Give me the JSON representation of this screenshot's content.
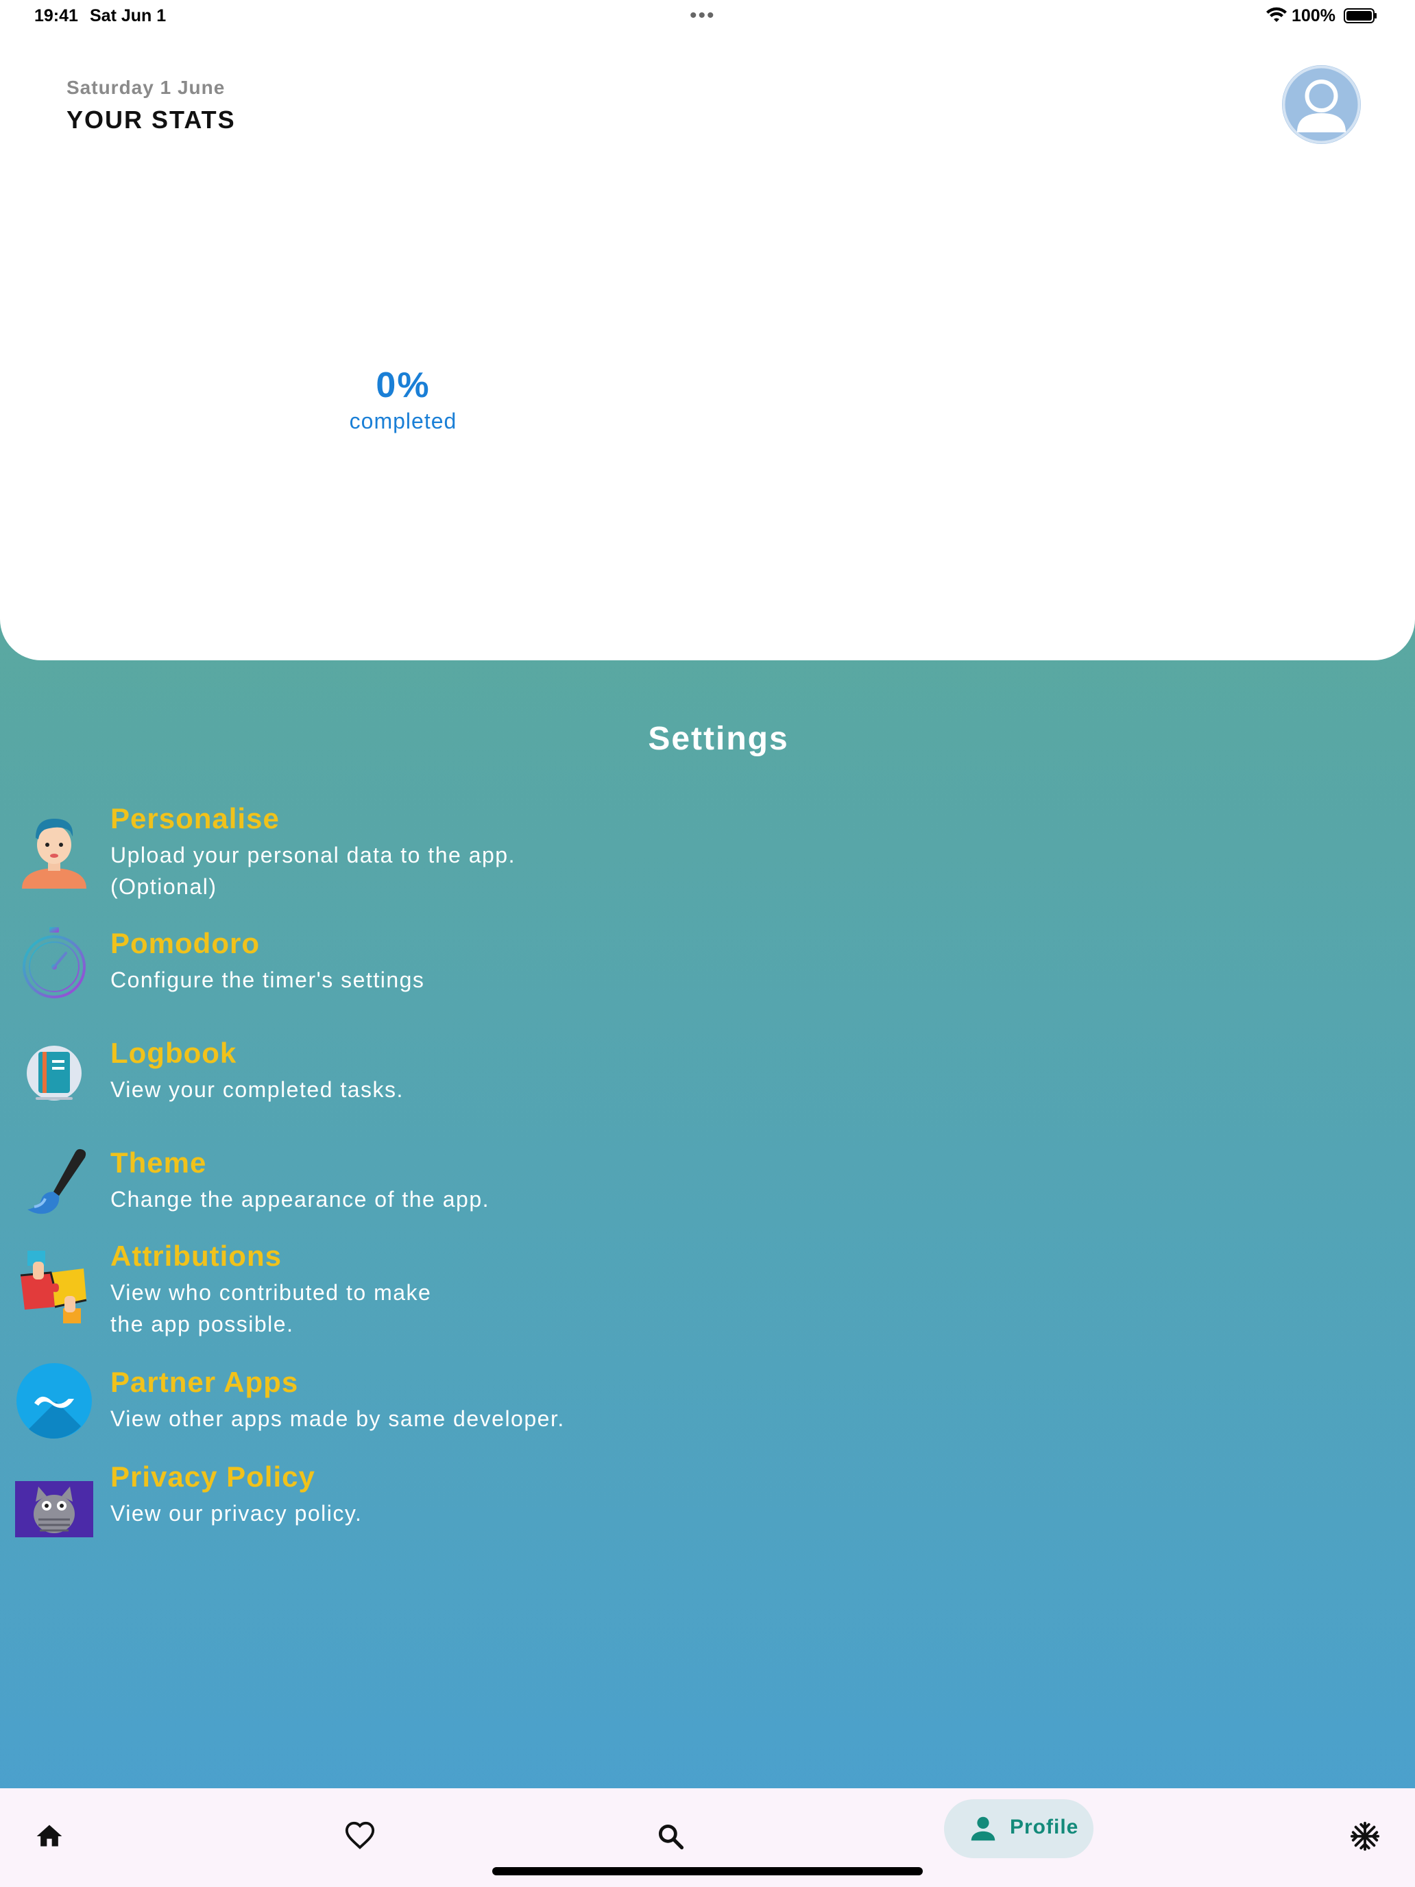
{
  "status_bar": {
    "time": "19:41",
    "date": "Sat Jun 1",
    "battery": "100%",
    "icons": [
      "wifi-icon",
      "battery-icon",
      "more-dots-icon"
    ]
  },
  "header": {
    "date": "Saturday 1 June",
    "title": "YOUR STATS"
  },
  "stats": {
    "progress_value": "0%",
    "progress_caption": "completed",
    "progress_fraction": 0
  },
  "settings": {
    "title": "Settings",
    "items": [
      {
        "title": "Personalise",
        "description": "Upload your personal data to the app.\n(Optional)",
        "icon": "person-avatar-icon"
      },
      {
        "title": "Pomodoro",
        "description": "Configure the timer's settings",
        "icon": "stopwatch-icon"
      },
      {
        "title": "Logbook",
        "description": "View your completed tasks.",
        "icon": "notebook-icon"
      },
      {
        "title": "Theme",
        "description": "Change the appearance of the app.",
        "icon": "paintbrush-icon"
      },
      {
        "title": "Attributions",
        "description": "View who contributed to make\nthe app possible.",
        "icon": "puzzle-hands-icon"
      },
      {
        "title": "Partner Apps",
        "description": "View other apps made by same developer.",
        "icon": "partner-app-icon"
      },
      {
        "title": "Privacy Policy",
        "description": "View our privacy policy.",
        "icon": "cat-icon"
      }
    ]
  },
  "bottom_nav": {
    "items": [
      {
        "icon": "home-icon"
      },
      {
        "icon": "heart-icon"
      },
      {
        "icon": "search-icon"
      },
      {
        "icon": "person-icon",
        "label": "Profile",
        "selected": true
      },
      {
        "icon": "snowflake-icon"
      }
    ]
  },
  "colors": {
    "accent_title": "#f1c21b",
    "progress_text": "#1a7fd6",
    "gradient_top": "#5fae8c",
    "gradient_bottom": "#4aa0d0",
    "nav_selected_text": "#138a7a",
    "nav_background": "#fbf3fb"
  }
}
